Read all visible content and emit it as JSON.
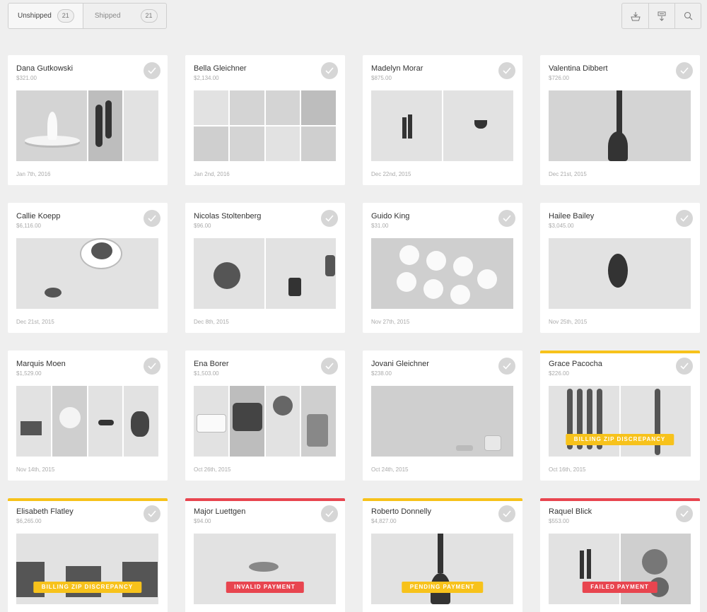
{
  "tabs": [
    {
      "label": "Unshipped",
      "count": "21"
    },
    {
      "label": "Shipped",
      "count": "21"
    }
  ],
  "toolbar": {
    "icons": [
      "basket-download-icon",
      "export-icon",
      "search-icon"
    ]
  },
  "colors": {
    "warning": "#f7c21b",
    "danger": "#e8454f",
    "check": "#d6d6d6"
  },
  "orders": [
    {
      "name": "Dana Gutkowski",
      "price": "$321.00",
      "date": "Jan 7th, 2016"
    },
    {
      "name": "Bella Gleichner",
      "price": "$2,134.00",
      "date": "Jan 2nd, 2016"
    },
    {
      "name": "Madelyn Morar",
      "price": "$875.00",
      "date": "Dec 22nd, 2015"
    },
    {
      "name": "Valentina Dibbert",
      "price": "$726.00",
      "date": "Dec 21st, 2015"
    },
    {
      "name": "Callie Koepp",
      "price": "$6,116.00",
      "date": "Dec 21st, 2015"
    },
    {
      "name": "Nicolas Stoltenberg",
      "price": "$96.00",
      "date": "Dec 8th, 2015"
    },
    {
      "name": "Guido King",
      "price": "$31.00",
      "date": "Nov 27th, 2015"
    },
    {
      "name": "Hailee Bailey",
      "price": "$3,045.00",
      "date": "Nov 25th, 2015"
    },
    {
      "name": "Marquis Moen",
      "price": "$1,529.00",
      "date": "Nov 14th, 2015"
    },
    {
      "name": "Ena Borer",
      "price": "$1,503.00",
      "date": "Oct 26th, 2015"
    },
    {
      "name": "Jovani Gleichner",
      "price": "$238.00",
      "date": "Oct 24th, 2015"
    },
    {
      "name": "Grace Pacocha",
      "price": "$226.00",
      "date": "Oct 16th, 2015",
      "badge": "BILLING ZIP DISCREPANCY"
    },
    {
      "name": "Elisabeth Flatley",
      "price": "$6,265.00",
      "badge": "BILLING ZIP DISCREPANCY"
    },
    {
      "name": "Major Luettgen",
      "price": "$94.00",
      "badge": "INVALID PAYMENT"
    },
    {
      "name": "Roberto Donnelly",
      "price": "$4,827.00",
      "badge": "PENDING PAYMENT"
    },
    {
      "name": "Raquel Blick",
      "price": "$553.00",
      "badge": "FAILED PAYMENT"
    }
  ]
}
